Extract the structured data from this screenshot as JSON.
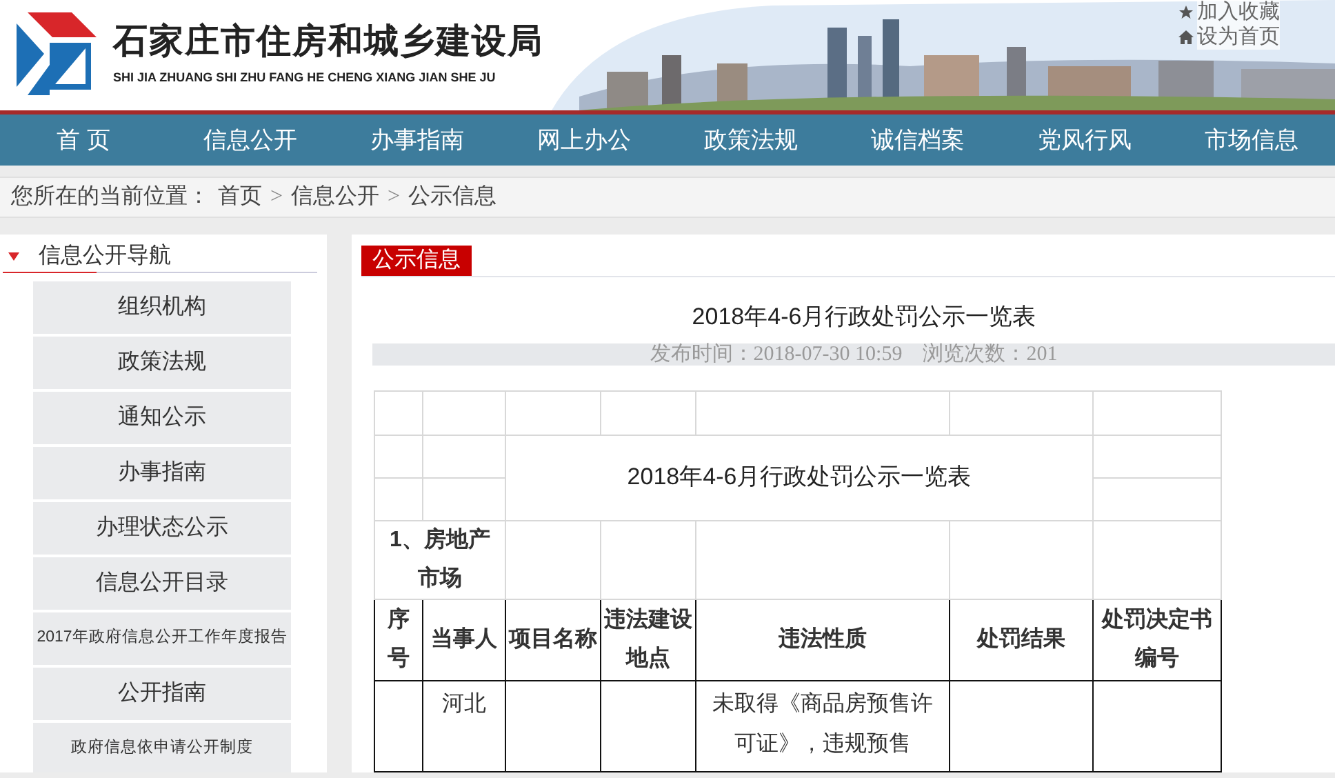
{
  "header": {
    "site_title": "石家庄市住房和城乡建设局",
    "site_subtitle": "SHI JIA ZHUANG SHI ZHU FANG HE CHENG XIANG JIAN SHE JU",
    "links": [
      {
        "kind": "star",
        "label": "加入收藏"
      },
      {
        "kind": "home",
        "label": "设为首页"
      }
    ]
  },
  "nav": [
    {
      "label": "首 页"
    },
    {
      "label": "信息公开"
    },
    {
      "label": "办事指南"
    },
    {
      "label": "网上办公"
    },
    {
      "label": "政策法规"
    },
    {
      "label": "诚信档案"
    },
    {
      "label": "党风行风"
    },
    {
      "label": "市场信息"
    }
  ],
  "breadcrumb": {
    "prefix": "您所在的当前位置：",
    "items": [
      "首页",
      "信息公开",
      "公示信息"
    ],
    "separator": ">"
  },
  "sidebar": {
    "title": "信息公开导航",
    "expanded": true,
    "items": [
      "组织机构",
      "政策法规",
      "通知公示",
      "办事指南",
      "办理状态公示",
      "信息公开目录",
      "2017年政府信息公开工作年度报告",
      "公开指南",
      "政府信息依申请公开制度"
    ]
  },
  "content": {
    "section_tab": "公示信息",
    "article_title": "2018年4-6月行政处罚公示一览表",
    "meta": "发布时间：2018-07-30 10:59　浏览次数：201",
    "table": {
      "title": "2018年4-6月行政处罚公示一览表",
      "section": "1、房地产市场",
      "columns": [
        "序号",
        "当事人",
        "项目名称",
        "违法建设地点",
        "违法性质",
        "处罚结果",
        "处罚决定书编号"
      ],
      "rows": [
        {
          "cells": [
            "",
            "河北",
            "",
            "",
            "未取得《商品房预售许可证》，违规预售",
            "",
            ""
          ]
        }
      ]
    }
  }
}
